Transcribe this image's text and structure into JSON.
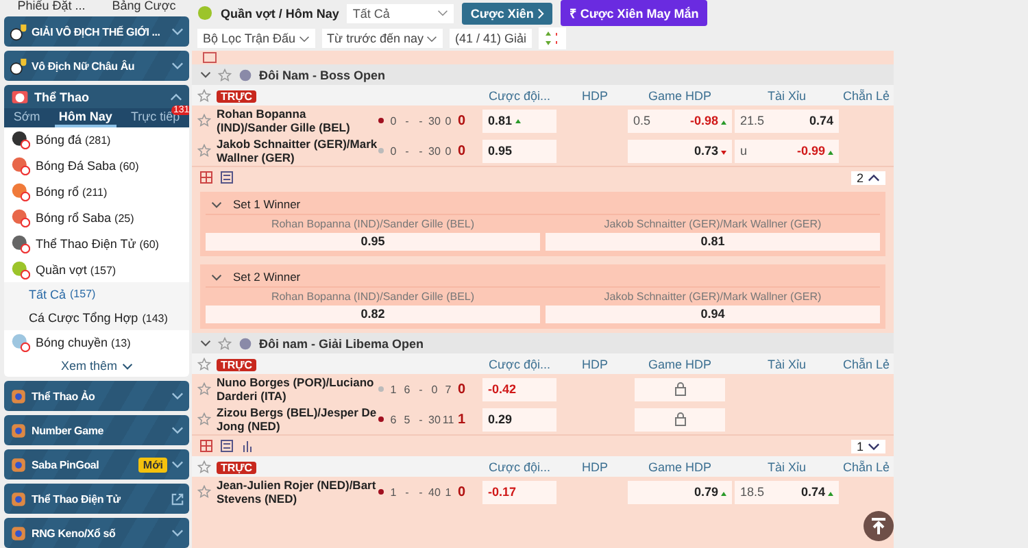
{
  "sidebar": {
    "top_tabs": [
      "Phiếu Đặt ...",
      "Bảng Cược"
    ],
    "banners": [
      {
        "label": "GIẢI VÔ ĐỊCH THẾ GIỚI ...",
        "expanded": false
      },
      {
        "label": "Vô Địch Nữ Châu Âu",
        "expanded": false
      }
    ],
    "sports": {
      "title": "Thể Thao",
      "expanded": true,
      "tabs": [
        {
          "label": "Sớm",
          "selected": false
        },
        {
          "label": "Hôm Nay",
          "selected": true
        },
        {
          "label": "Trực tiếp",
          "selected": false,
          "badge": "131"
        }
      ],
      "items": [
        {
          "label": "Bóng đá",
          "count": "(281)",
          "color": "#333333"
        },
        {
          "label": "Bóng Đá Saba",
          "count": "(60)",
          "color": "#e8674a"
        },
        {
          "label": "Bóng rổ",
          "count": "(211)",
          "color": "#f07a3a"
        },
        {
          "label": "Bóng rổ Saba",
          "count": "(25)",
          "color": "#e8674a"
        },
        {
          "label": "Thể Thao Điện Tử",
          "count": "(60)",
          "color": "#666666"
        },
        {
          "label": "Quần vợt",
          "count": "(157)",
          "color": "#9cc42a",
          "children": [
            {
              "label": "Tất Cả",
              "count": "(157)",
              "selected": true
            },
            {
              "label": "Cá Cược Tổng Hợp",
              "count": "(143)",
              "selected": false
            }
          ]
        },
        {
          "label": "Bóng chuyền",
          "count": "(13)",
          "color": "#9ec6e0"
        }
      ],
      "more": "Xem thêm"
    },
    "menus": [
      {
        "label": "Thể Thao Ảo",
        "kind": "expand"
      },
      {
        "label": "Number Game",
        "kind": "expand"
      },
      {
        "label": "Saba PinGoal",
        "kind": "expand",
        "badge": "Mới"
      },
      {
        "label": "Thể Thao Điện Tử",
        "kind": "external"
      },
      {
        "label": "RNG Keno/Xổ số",
        "kind": "expand"
      }
    ]
  },
  "main": {
    "breadcrumb": "Quần vợt / Hôm Nay",
    "select": "Tất Cả",
    "buttons": [
      {
        "label": "Cược Xiên",
        "kind": "parlay"
      },
      {
        "label": "Cược Xiên May Mắn",
        "kind": "lucky",
        "icon": "₹"
      }
    ],
    "filters": [
      {
        "label": "Bộ Lọc Trận Đấu",
        "dropdown": true
      },
      {
        "label": "Từ trước đến nay",
        "dropdown": true
      },
      {
        "label": "(41 / 41) Giải",
        "dropdown": false
      }
    ],
    "leagues": [
      {
        "name": "Đôi Nam - Boss Open",
        "expanded": true,
        "matches": [
          {
            "live": "TRỰC",
            "columns": [
              "Cược đội...",
              "HDP",
              "Game HDP",
              "Tài Xỉu",
              "Chẵn Lẻ"
            ],
            "more": "2",
            "expanded": true,
            "teams": [
              {
                "name": "Rohan Bopanna (IND)/Sander Gille (BEL)",
                "serving": true,
                "scores": [
                  "0",
                  "-",
                  "-",
                  "30",
                  "0"
                ],
                "total": "0",
                "ml": {
                  "value": "0.81",
                  "negative": false,
                  "rising": true
                },
                "game_hdp": {
                  "line": "0.5",
                  "value": "-0.98",
                  "negative": true,
                  "rising": true
                },
                "ou": {
                  "line": "21.5",
                  "value": "0.74",
                  "negative": false
                }
              },
              {
                "name": "Jakob Schnaitter (GER)/Mark Wallner (GER)",
                "serving": false,
                "scores": [
                  "0",
                  "-",
                  "-",
                  "30",
                  "0"
                ],
                "total": "0",
                "ml": {
                  "value": "0.95",
                  "negative": false
                },
                "game_hdp": {
                  "value": "0.73",
                  "negative": false,
                  "rising": false
                },
                "ou": {
                  "line": "u",
                  "value": "-0.99",
                  "negative": true,
                  "rising": true
                }
              }
            ],
            "markets": [
              {
                "title": "Set 1 Winner",
                "options": [
                  {
                    "name": "Rohan Bopanna (IND)/Sander Gille (BEL)",
                    "odds": "0.95"
                  },
                  {
                    "name": "Jakob Schnaitter (GER)/Mark Wallner (GER)",
                    "odds": "0.81"
                  }
                ]
              },
              {
                "title": "Set 2 Winner",
                "options": [
                  {
                    "name": "Rohan Bopanna (IND)/Sander Gille (BEL)",
                    "odds": "0.82"
                  },
                  {
                    "name": "Jakob Schnaitter (GER)/Mark Wallner (GER)",
                    "odds": "0.94"
                  }
                ]
              }
            ]
          }
        ]
      },
      {
        "name": "Đôi nam - Giải Libema Open",
        "expanded": true,
        "matches": [
          {
            "live": "TRỰC",
            "columns": [
              "Cược đội...",
              "HDP",
              "Game HDP",
              "Tài Xỉu",
              "Chẵn Lẻ"
            ],
            "more": "1",
            "expanded": false,
            "teams": [
              {
                "name": "Nuno Borges (POR)/Luciano Darderi (ITA)",
                "serving": false,
                "scores": [
                  "1",
                  "6",
                  "-",
                  "0",
                  "7"
                ],
                "total": "0",
                "ml": {
                  "value": "-0.42",
                  "negative": true
                },
                "game_hdp": {
                  "locked": true
                }
              },
              {
                "name": "Zizou Bergs (BEL)/Jesper De Jong (NED)",
                "serving": true,
                "scores": [
                  "6",
                  "5",
                  "-",
                  "30",
                  "11"
                ],
                "total": "1",
                "ml": {
                  "value": "0.29",
                  "negative": false
                },
                "game_hdp": {
                  "locked": true
                }
              }
            ]
          },
          {
            "live": "TRỰC",
            "columns": [
              "Cược đội...",
              "HDP",
              "Game HDP",
              "Tài Xỉu",
              "Chẵn Lẻ"
            ],
            "teams": [
              {
                "name": "Jean-Julien Rojer (NED)/Bart Stevens (NED)",
                "serving": true,
                "scores": [
                  "1",
                  "-",
                  "-",
                  "40",
                  "1"
                ],
                "total": "0",
                "ml": {
                  "value": "-0.17",
                  "negative": true
                },
                "game_hdp": {
                  "value": "0.79",
                  "negative": false,
                  "rising": true
                },
                "ou": {
                  "line": "18.5",
                  "value": "0.74",
                  "negative": false,
                  "rising": true
                }
              }
            ]
          }
        ]
      }
    ]
  }
}
